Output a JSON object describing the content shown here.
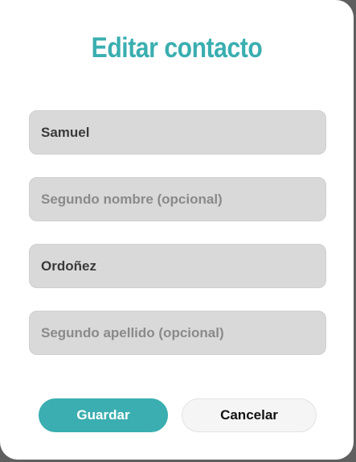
{
  "dialog": {
    "title": "Editar contacto"
  },
  "form": {
    "first_name": {
      "value": "Samuel",
      "placeholder": ""
    },
    "middle_name": {
      "value": "",
      "placeholder": "Segundo nombre (opcional)"
    },
    "last_name": {
      "value": "Ordoñez",
      "placeholder": ""
    },
    "second_last_name": {
      "value": "",
      "placeholder": "Segundo apellido (opcional)"
    }
  },
  "actions": {
    "save_label": "Guardar",
    "cancel_label": "Cancelar"
  },
  "colors": {
    "accent": "#3aaeb0",
    "field_bg": "#d9d9d9",
    "backdrop": "#5f5f5f"
  }
}
